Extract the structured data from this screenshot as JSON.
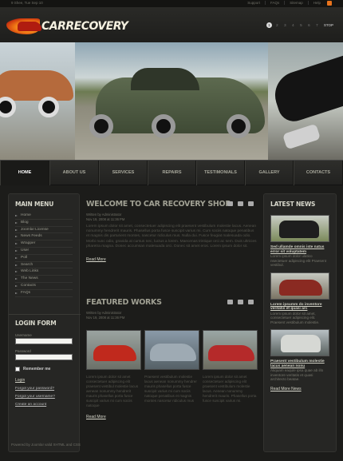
{
  "topbar": {
    "date": "9 Shee, Tue Sep 10",
    "links": [
      "Support",
      "FAQs",
      "Sitemap",
      "Help"
    ]
  },
  "logo": {
    "text": "CARRECOVERY"
  },
  "slider": {
    "pages": [
      "1",
      "2",
      "3",
      "4",
      "5",
      "6",
      "7"
    ],
    "active": 1,
    "stop_label": "STOP"
  },
  "nav": [
    "HOME",
    "ABOUT US",
    "SERVICES",
    "REPAIRS",
    "TESTIMONIALS",
    "GALLERY",
    "CONTACTS"
  ],
  "main_menu": {
    "title": "MAIN MENU",
    "items": [
      "Home",
      "Blog",
      "Joomla! License",
      "News Feeds",
      "Wrapper",
      "User",
      "Poll",
      "Search",
      "Web Links",
      "The News",
      "Contacts",
      "FAQs"
    ]
  },
  "login": {
    "title": "LOGIN FORM",
    "username_label": "Username",
    "password_label": "Password",
    "remember_label": "Remember me",
    "login_button": "Login",
    "forgot_password": "Forgot your password?",
    "forgot_username": "Forgot your username?",
    "create_account": "Create an account"
  },
  "welcome": {
    "title": "WELCOME TO CAR RECOVERY SHOP",
    "author": "Written by Administrator",
    "date": "Nov 19, 2008 at 11:36 PM",
    "body": "Lorem ipsum dolor sit amet, consectetuer adipiscing elit praesent vestibulum molestie lacus. Aenean nonummy hendrerit mauris. Phasellus porta fusce suscipit varius mi. Cum sociis natoque penatibus et magnis dis parturient montes, nascetur ridiculus mus. Nulla dui. Fusce feugiat malesuada odio. Morbi nunc odio, gravida at cursus nec, luctus a lorem. Maecenas tristique orci ac sem. Duis ultricies pharetra magna. Donec accumsan malesuada orci. Donec sit amet eros. Lorem ipsum dolor sit.",
    "read_more": "Read More"
  },
  "featured": {
    "title": "FEATURED WORKS",
    "author": "Written by Administrator",
    "date": "Nov 19, 2008 at 11:36 PM",
    "items": [
      "Lorem ipsum dolor sit amet consectetuer adipiscing elit praesent vestibul molestie lacus aenean nonummy hendrerit mauris phasellus porta fusce suscipit varius mi cum sociis natoque",
      "Praesent vestibulum molestie lacus aenean nonummy hendrer mauris phasellus porta fusce suscipit varius mi cum sociis natoque penatibus et magnis montes nascetur ridiculus mus",
      "Lorem ipsum dolor sit amet consectetuer adipiscing elit praesent vestibulum molestie lacus. Aenean nonummy hendrerit mauris. Phasellus porta fusce suscipit varius mi."
    ],
    "read_more": "Read More"
  },
  "latest_news": {
    "title": "LATEST NEWS",
    "items": [
      {
        "title": "Sed ullamde omnis iste natus error sit voluptatem",
        "text": "Lorem ipsum dolor ulatico nsectetuer adipiscing elit Praesent vestibul."
      },
      {
        "title": "Lorem ipsumm do inventore veritatis et quasi arc",
        "text": "Lorem ipsum dolor sit amet, consectetuer adipiscing elit. Praesent vestibulum molestie."
      },
      {
        "title": "Praesent vestibulum molestie lacus aenean nonu",
        "text": "Aliquam eaqule ipsa quae ab illo inventore veritatis et quasi architecto beatae."
      }
    ],
    "read_more": "Read More News"
  },
  "footer": {
    "text": "Powered by Joomla! valid XHTML and CSS"
  }
}
